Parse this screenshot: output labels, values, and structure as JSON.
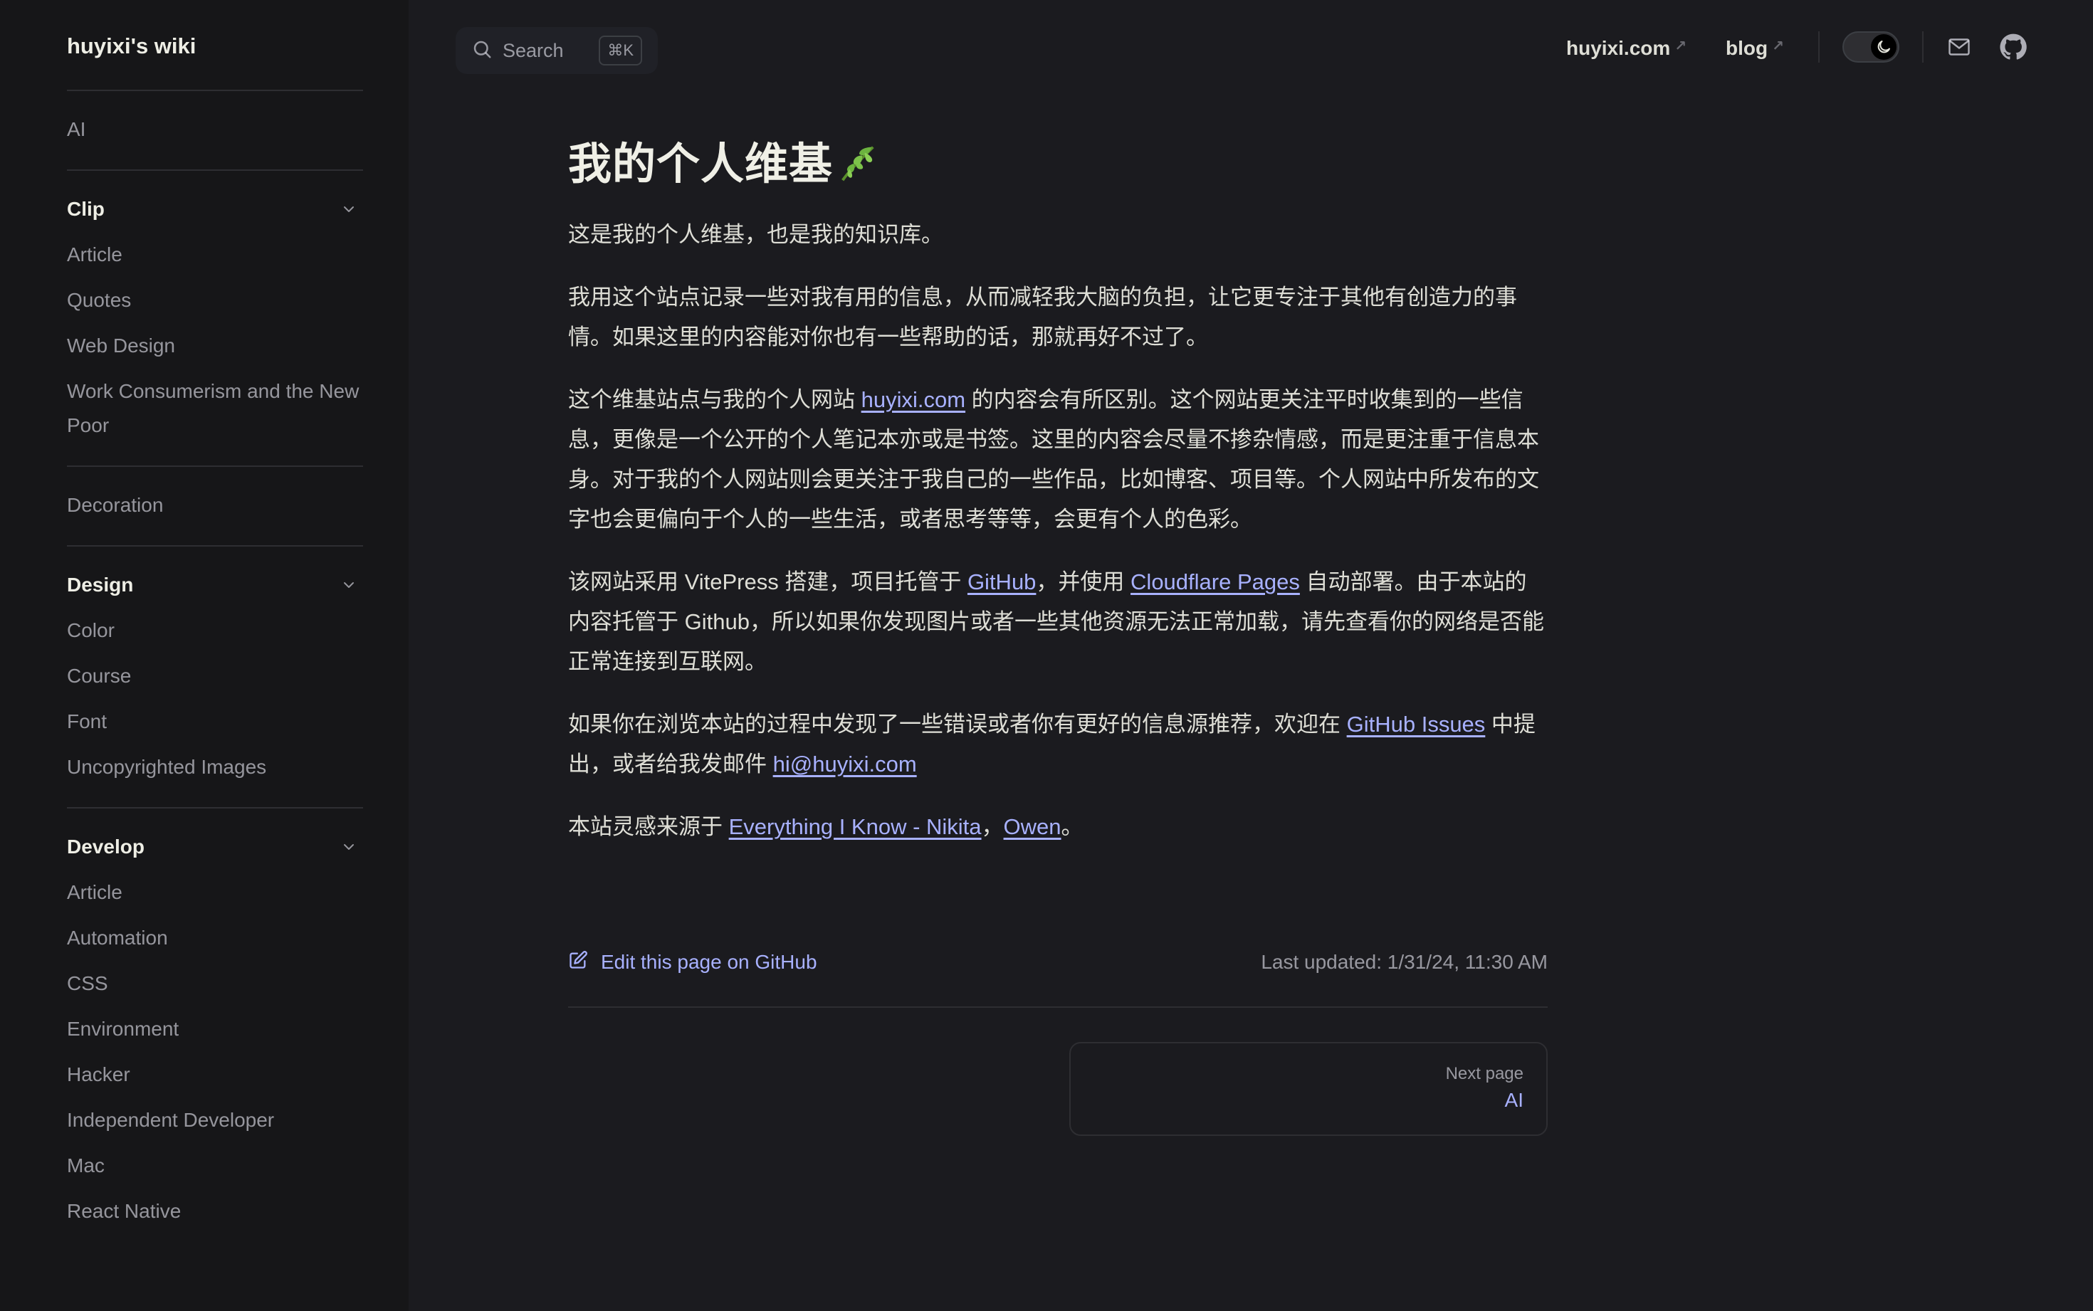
{
  "site": {
    "title": "huyixi's wiki"
  },
  "sidebar": {
    "groups": [
      {
        "heading": "",
        "items": [
          "AI"
        ]
      },
      {
        "heading": "Clip",
        "items": [
          "Article",
          "Quotes",
          "Web Design",
          "Work Consumerism and the New Poor"
        ]
      },
      {
        "heading": "",
        "items": [
          "Decoration"
        ]
      },
      {
        "heading": "Design",
        "items": [
          "Color",
          "Course",
          "Font",
          "Uncopyrighted Images"
        ]
      },
      {
        "heading": "Develop",
        "items": [
          "Article",
          "Automation",
          "CSS",
          "Environment",
          "Hacker",
          "Independent Developer",
          "Mac",
          "React Native"
        ]
      }
    ]
  },
  "topbar": {
    "search_label": "Search",
    "search_shortcut": "⌘K",
    "nav": [
      {
        "label": "huyixi.com",
        "external_mark": "↗"
      },
      {
        "label": "blog",
        "external_mark": "↗"
      }
    ],
    "icons": [
      "moon-icon",
      "mail-icon",
      "github-icon"
    ]
  },
  "page": {
    "title": "我的个人维基",
    "title_emoji": "leaf-icon",
    "paragraphs": [
      [
        {
          "t": "这是我的个人维基，也是我的知识库。"
        }
      ],
      [
        {
          "t": "我用这个站点记录一些对我有用的信息，从而减轻我大脑的负担，让它更专注于其他有创造力的事情。如果这里的内容能对你也有一些帮助的话，那就再好不过了。"
        }
      ],
      [
        {
          "t": "这个维基站点与我的个人网站 "
        },
        {
          "link": "huyixi.com"
        },
        {
          "t": " 的内容会有所区别。这个网站更关注平时收集到的一些信息，更像是一个公开的个人笔记本亦或是书签。这里的内容会尽量不掺杂情感，而是更注重于信息本身。对于我的个人网站则会更关注于我自己的一些作品，比如博客、项目等。个人网站中所发布的文字也会更偏向于个人的一些生活，或者思考等等，会更有个人的色彩。"
        }
      ],
      [
        {
          "t": "该网站采用 VitePress 搭建，项目托管于 "
        },
        {
          "link": "GitHub"
        },
        {
          "t": "，并使用 "
        },
        {
          "link": "Cloudflare Pages"
        },
        {
          "t": " 自动部署。由于本站的内容托管于 Github，所以如果你发现图片或者一些其他资源无法正常加载，请先查看你的网络是否能正常连接到互联网。"
        }
      ],
      [
        {
          "t": "如果你在浏览本站的过程中发现了一些错误或者你有更好的信息源推荐，欢迎在 "
        },
        {
          "link": "GitHub Issues"
        },
        {
          "t": " 中提出，或者给我发邮件 "
        },
        {
          "link": "hi@huyixi.com"
        }
      ],
      [
        {
          "t": "本站灵感来源于 "
        },
        {
          "link": "Everything I Know - Nikita"
        },
        {
          "t": "，"
        },
        {
          "link": "Owen"
        },
        {
          "t": "。"
        }
      ]
    ]
  },
  "footer": {
    "edit_label": "Edit this page on GitHub",
    "last_updated_label": "Last updated:",
    "last_updated_value": "1/31/24, 11:30 AM",
    "next_desc": "Next page",
    "next_title": "AI"
  },
  "colors": {
    "background": "#1b1b1f",
    "sidebar": "#161618",
    "brand_link": "#a8b1ff",
    "divider": "#2e2e32"
  }
}
